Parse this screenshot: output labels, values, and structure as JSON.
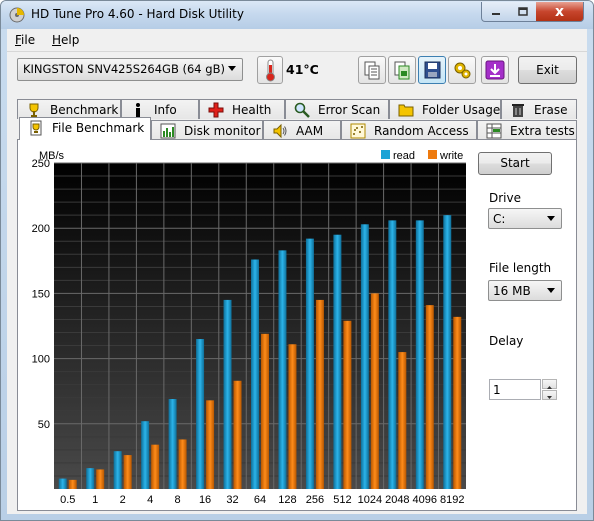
{
  "window": {
    "title": "HD Tune Pro 4.60 - Hard Disk Utility",
    "close_glyph": "x",
    "icons": [
      "app-icon",
      "minimize-icon",
      "maximize-icon",
      "close-icon"
    ]
  },
  "menu": [
    {
      "label": "File",
      "accel": "F"
    },
    {
      "label": "Help",
      "accel": "H"
    }
  ],
  "toolbar": {
    "drive": "KINGSTON SNV425S264GB (64 gB)",
    "temperature": "41°C",
    "exit_label": "Exit",
    "buttons": [
      "copy-info-icon",
      "copy-screenshot-icon",
      "save-icon",
      "options-icon",
      "download-icon"
    ]
  },
  "tabs_row1": [
    {
      "label": "Benchmark",
      "icon": "benchmark-icon"
    },
    {
      "label": "Info",
      "icon": "info-icon"
    },
    {
      "label": "Health",
      "icon": "health-icon"
    },
    {
      "label": "Error Scan",
      "icon": "error-scan-icon"
    },
    {
      "label": "Folder Usage",
      "icon": "folder-icon"
    },
    {
      "label": "Erase",
      "icon": "trash-icon"
    }
  ],
  "tabs_row2": [
    {
      "label": "File Benchmark",
      "icon": "file-benchmark-icon",
      "active": true
    },
    {
      "label": "Disk monitor",
      "icon": "disk-monitor-icon"
    },
    {
      "label": "AAM",
      "icon": "speaker-icon"
    },
    {
      "label": "Random Access",
      "icon": "random-access-icon"
    },
    {
      "label": "Extra tests",
      "icon": "extra-tests-icon"
    }
  ],
  "side_panel": {
    "start_label": "Start",
    "drive_label": "Drive",
    "drive_value": "C:",
    "file_length_label": "File length",
    "file_length_value": "16 MB",
    "delay_label": "Delay",
    "delay_value": "1"
  },
  "colors": {
    "read": "#1ba3d6",
    "write": "#ee7a0e",
    "plot_bg_top": "#000000",
    "plot_bg_bottom": "#4a4a4a",
    "grid": "#6a6a6a"
  },
  "chart_data": {
    "type": "bar",
    "ylabel": "MB/s",
    "xlabel": "",
    "ylim": [
      0,
      250
    ],
    "yticks": [
      "50",
      "100",
      "150",
      "200",
      "250"
    ],
    "categories": [
      "0.5",
      "1",
      "2",
      "4",
      "8",
      "16",
      "32",
      "64",
      "128",
      "256",
      "512",
      "1024",
      "2048",
      "4096",
      "8192"
    ],
    "series": [
      {
        "name": "read",
        "values": [
          8,
          16,
          29,
          52,
          69,
          115,
          145,
          176,
          183,
          192,
          195,
          203,
          206,
          206,
          210
        ]
      },
      {
        "name": "write",
        "values": [
          7,
          15,
          26,
          34,
          38,
          68,
          83,
          119,
          111,
          145,
          129,
          150,
          105,
          141,
          132
        ]
      }
    ],
    "legend": "top-right",
    "grid": true
  }
}
